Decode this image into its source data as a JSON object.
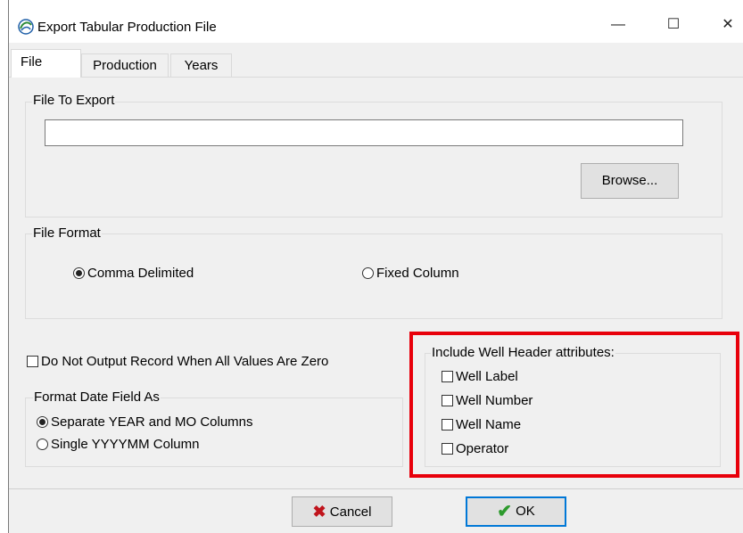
{
  "window": {
    "title": "Export Tabular Production File",
    "minimize_symbol": "—",
    "maximize_symbol": "☐",
    "close_symbol": "✕",
    "icon": "app-swirl-icon"
  },
  "tabs": [
    {
      "label": "File",
      "active": true
    },
    {
      "label": "Production",
      "active": false
    },
    {
      "label": "Years",
      "active": false
    }
  ],
  "file_to_export": {
    "legend": "File To Export",
    "value": "",
    "browse_label": "Browse..."
  },
  "file_format": {
    "legend": "File Format",
    "options": [
      {
        "label": "Comma Delimited",
        "selected": true
      },
      {
        "label": "Fixed Column",
        "selected": false
      }
    ]
  },
  "zero_option": {
    "label": "Do Not Output Record When All Values Are Zero",
    "checked": false
  },
  "date_format": {
    "legend": "Format Date Field As",
    "options": [
      {
        "label": "Separate YEAR and MO Columns",
        "selected": true
      },
      {
        "label": "Single YYYYMM Column",
        "selected": false
      }
    ]
  },
  "well_header": {
    "legend": "Include Well Header attributes:",
    "items": [
      {
        "label": "Well Label",
        "checked": false
      },
      {
        "label": "Well Number",
        "checked": false
      },
      {
        "label": "Well Name",
        "checked": false
      },
      {
        "label": "Operator",
        "checked": false
      }
    ],
    "highlight_color": "#e8000b"
  },
  "buttons": {
    "cancel_label": "Cancel",
    "ok_label": "OK",
    "cancel_icon": "red-x-icon",
    "ok_icon": "green-check-icon"
  }
}
